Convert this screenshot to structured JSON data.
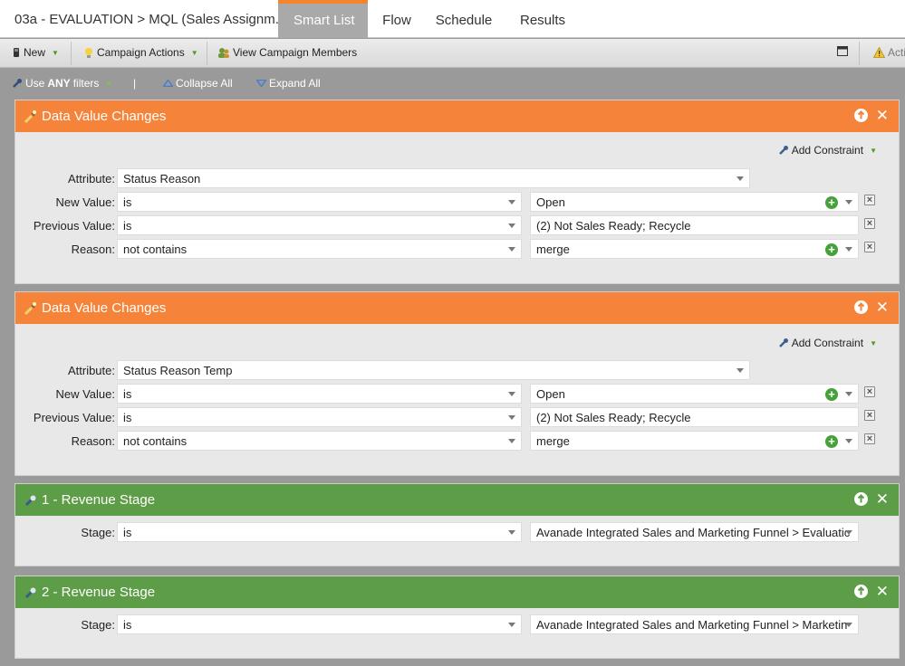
{
  "header": {
    "title": "03a - EVALUATION > MQL (Sales Assignm...",
    "tabs": [
      {
        "label": "Smart List",
        "active": true
      },
      {
        "label": "Flow"
      },
      {
        "label": "Schedule"
      },
      {
        "label": "Results"
      }
    ]
  },
  "toolbar": {
    "new_label": "New",
    "campaign_actions_label": "Campaign Actions",
    "view_members_label": "View Campaign Members",
    "actions_label": "Acti"
  },
  "filterbar": {
    "use_label": "Use",
    "any_label": "ANY",
    "filters_label": "filters",
    "separator": "|",
    "collapse_label": "Collapse All",
    "expand_label": "Expand All"
  },
  "filters": [
    {
      "title": "Data Value Changes",
      "add_constraint": "Add Constraint",
      "attribute_label": "Attribute:",
      "attribute_value": "Status Reason",
      "rows": [
        {
          "label": "New Value:",
          "operator": "is",
          "value": "Open"
        },
        {
          "label": "Previous Value:",
          "operator": "is",
          "value": "(2) Not Sales Ready; Recycle"
        },
        {
          "label": "Reason:",
          "operator": "not contains",
          "value": "merge"
        }
      ]
    },
    {
      "title": "Data Value Changes",
      "add_constraint": "Add Constraint",
      "attribute_label": "Attribute:",
      "attribute_value": "Status Reason Temp",
      "rows": [
        {
          "label": "New Value:",
          "operator": "is",
          "value": "Open"
        },
        {
          "label": "Previous Value:",
          "operator": "is",
          "value": "(2) Not Sales Ready; Recycle"
        },
        {
          "label": "Reason:",
          "operator": "not contains",
          "value": "merge"
        }
      ]
    },
    {
      "title": "1 - Revenue Stage",
      "rows": [
        {
          "label": "Stage:",
          "operator": "is",
          "value": "Avanade Integrated Sales and Marketing Funnel > Evaluatic"
        }
      ]
    },
    {
      "title": "2 - Revenue Stage",
      "rows": [
        {
          "label": "Stage:",
          "operator": "is",
          "value": "Avanade Integrated Sales and Marketing Funnel > Marketin"
        }
      ]
    }
  ],
  "colors": {
    "orange": "#f5843a",
    "green": "#5e9d47",
    "accent_tab": "#f5842a"
  },
  "icons": {
    "filter1": "data-value-change-icon",
    "filter3": "revenue-stage-icon"
  }
}
